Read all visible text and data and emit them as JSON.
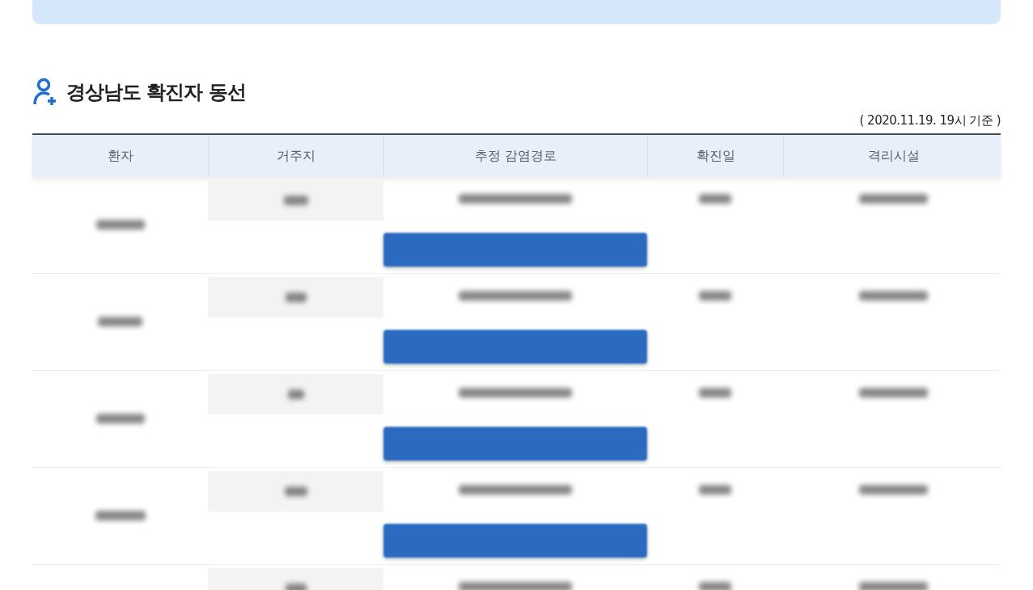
{
  "banner": {
    "kind": "notice"
  },
  "section": {
    "title": "경상남도 확진자 동선",
    "as_of": "( 2020.11.19. 19시 기준 )"
  },
  "table": {
    "columns": [
      "환자",
      "거주지",
      "추정 감염경로",
      "확진일",
      "격리시설"
    ],
    "rows": [
      {
        "redacted": true,
        "has_button": true
      },
      {
        "redacted": true,
        "has_button": true
      },
      {
        "redacted": true,
        "has_button": true
      },
      {
        "redacted": true,
        "has_button": true
      },
      {
        "redacted": true,
        "has_button": false
      }
    ]
  }
}
